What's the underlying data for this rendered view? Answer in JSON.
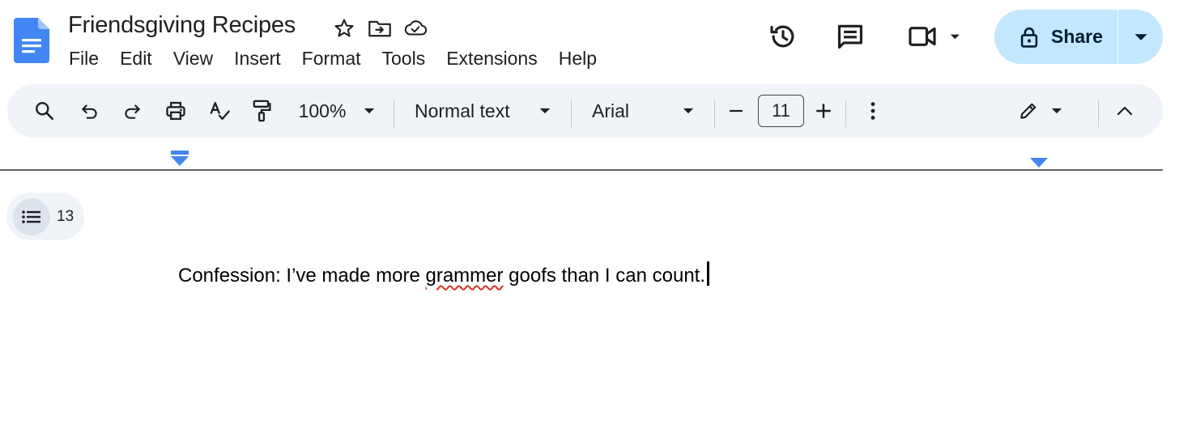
{
  "app": {
    "document_title": "Friendsgiving Recipes",
    "title_icons": [
      "star-icon",
      "move-to-folder-icon",
      "cloud-saved-icon"
    ]
  },
  "menubar": {
    "items": [
      "File",
      "Edit",
      "View",
      "Insert",
      "Format",
      "Tools",
      "Extensions",
      "Help"
    ]
  },
  "header_actions": {
    "icons": [
      "version-history-icon",
      "comments-icon",
      "meet-video-icon"
    ],
    "share_label": "Share"
  },
  "toolbar": {
    "zoom": "100%",
    "paragraph_style": "Normal text",
    "font_family": "Arial",
    "font_size": "11",
    "icons": [
      "search-icon",
      "undo-icon",
      "redo-icon",
      "print-icon",
      "spellcheck-icon",
      "paint-format-icon",
      "more-options-icon",
      "editing-mode-icon",
      "collapse-menus-icon"
    ]
  },
  "outline": {
    "count": "13"
  },
  "document": {
    "text_before": "Confession: I’ve made more ",
    "misspelled_word": "grammer",
    "text_after": " goofs than I can count."
  },
  "colors": {
    "share_bg": "#c2e7ff",
    "toolbar_bg": "#f0f4f9",
    "docs_blue": "#4285f4",
    "spell_error": "#d93025"
  }
}
